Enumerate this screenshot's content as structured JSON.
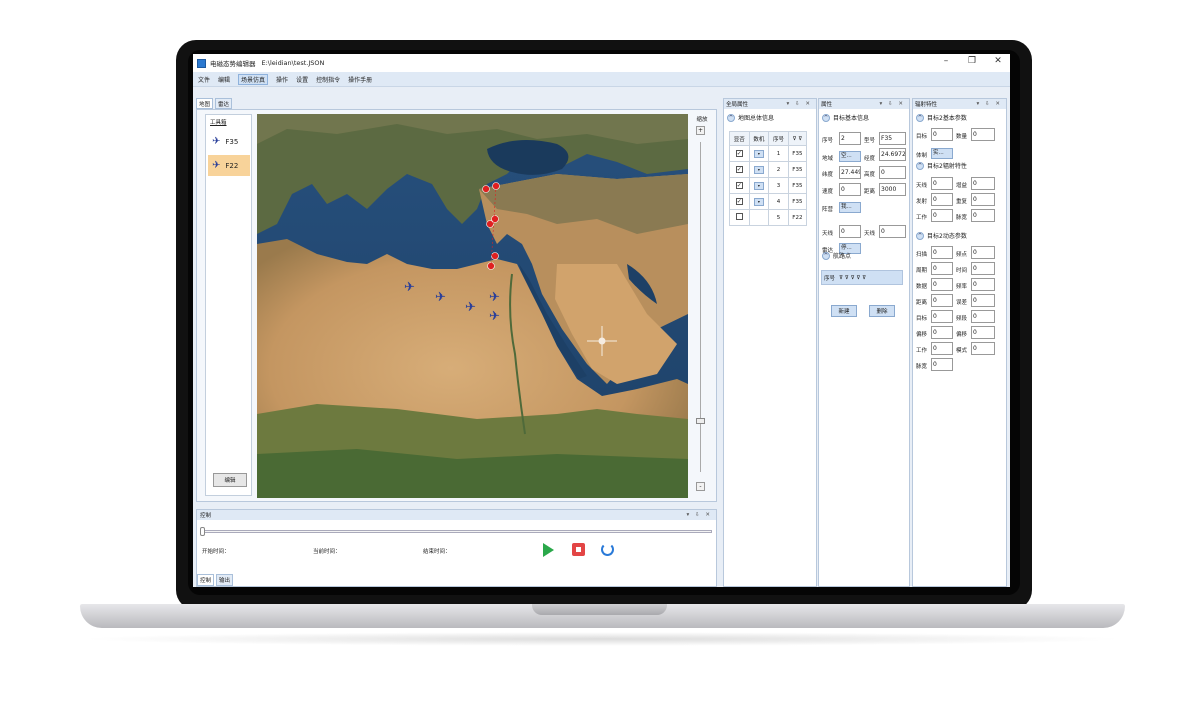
{
  "app": {
    "title": "电磁态势编辑器",
    "file_path": "E:\\leidian\\test.JSON"
  },
  "window": {
    "minimize": "–",
    "maximize": "❐",
    "close": "✕"
  },
  "menu": [
    "文件",
    "编辑",
    "场景仿真",
    "操作",
    "设置",
    "控制指令",
    "操作手册"
  ],
  "main_tabs": [
    "地图",
    "雷达"
  ],
  "toolbox": {
    "title": "工具箱",
    "items": [
      {
        "label": "F35",
        "icon": "fighter-jet-icon"
      },
      {
        "label": "F22",
        "icon": "fighter-jet-icon",
        "selected": true
      }
    ],
    "edit_button": "编辑"
  },
  "zoom": {
    "label": "缩放",
    "plus": "+",
    "minus": "-"
  },
  "control": {
    "title": "控制",
    "start_time": "开始时间：",
    "current_time": "当前时间：",
    "end_time": "结束时间：",
    "tabs": [
      "控制",
      "输出"
    ]
  },
  "global_panel": {
    "title": "全局属性",
    "section": "地图总体信息",
    "columns": [
      "显否",
      "数机",
      "序号"
    ],
    "rows": [
      {
        "checked": true,
        "index": "1",
        "type": "F35"
      },
      {
        "checked": true,
        "index": "2",
        "type": "F35"
      },
      {
        "checked": true,
        "index": "3",
        "type": "F35"
      },
      {
        "checked": true,
        "index": "4",
        "type": "F35"
      },
      {
        "checked": false,
        "index": "5",
        "type": "F22"
      }
    ]
  },
  "attr_panel": {
    "title": "属性",
    "section_basic": "目标基本信息",
    "fields": {
      "seq_label": "序号",
      "seq": "2",
      "model_label": "型号",
      "model": "F35",
      "domain_label": "地域",
      "domain": "空...",
      "lon_label": "经度",
      "lon": "24.6972",
      "lat_label": "纬度",
      "lat": "27.4492",
      "alt_label": "高度",
      "alt": "0",
      "speed_label": "速度",
      "speed": "0",
      "dist_label": "距离",
      "dist": "3000",
      "camp_label": "阵营",
      "camp": "我...",
      "ant_label": "天线",
      "ant": "0",
      "ant2_label": "天线",
      "ant2": "0",
      "radar_label": "雷达",
      "radar": "停..."
    },
    "section_waypoints": "航路点",
    "wp_col": "序号",
    "new_btn": "新建",
    "del_btn": "删除"
  },
  "rad_panel": {
    "title": "辐射特性",
    "section1": "目标2基本参数",
    "s1": [
      {
        "l": "目标",
        "v": "0"
      },
      {
        "l": "数量",
        "v": "0"
      }
    ],
    "type_label": "体制",
    "type_value": "实...",
    "section2": "目标2辐射特性",
    "s2": [
      {
        "l": "天线",
        "v": "0"
      },
      {
        "l": "增益",
        "v": "0"
      },
      {
        "l": "发射",
        "v": "0"
      },
      {
        "l": "重复",
        "v": "0"
      },
      {
        "l": "工作",
        "v": "0"
      },
      {
        "l": "脉宽",
        "v": "0"
      }
    ],
    "section3": "目标2动态参数",
    "s3": [
      {
        "l": "扫描",
        "v": "0"
      },
      {
        "l": "频点",
        "v": "0"
      },
      {
        "l": "周期",
        "v": "0"
      },
      {
        "l": "时间",
        "v": "0"
      },
      {
        "l": "数据",
        "v": "0"
      },
      {
        "l": "频率",
        "v": "0"
      },
      {
        "l": "距离",
        "v": "0"
      },
      {
        "l": "误差",
        "v": "0"
      },
      {
        "l": "目标",
        "v": "0"
      },
      {
        "l": "频段",
        "v": "0"
      },
      {
        "l": "偏移",
        "v": "0"
      },
      {
        "l": "偏移",
        "v": "0"
      },
      {
        "l": "工作",
        "v": "0"
      },
      {
        "l": "模式",
        "v": "0"
      },
      {
        "l": "脉宽",
        "v": "0"
      }
    ]
  },
  "colors": {
    "accent": "#2b79d0",
    "selected": "#f8d39a",
    "play": "#2aa84a",
    "stop": "#e34545",
    "marker": "#e02020",
    "aircraft": "#2a3f9a"
  }
}
